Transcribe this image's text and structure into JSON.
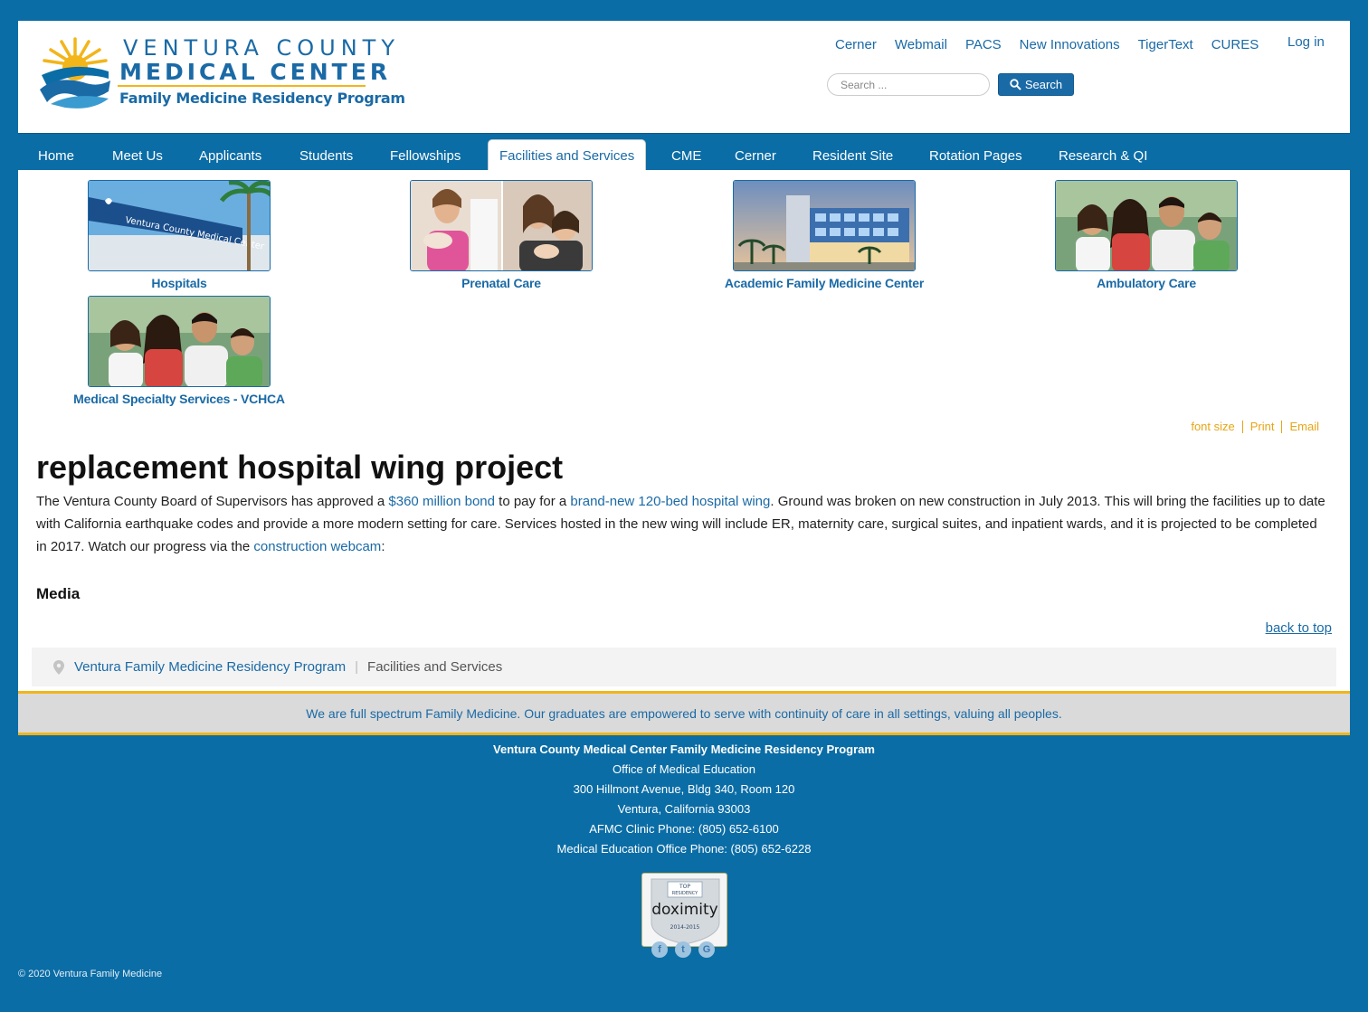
{
  "logo": {
    "line1": "VENTURA COUNTY",
    "line2": "MEDICAL CENTER",
    "line3": "Family Medicine Residency Program"
  },
  "header": {
    "links": [
      "Cerner",
      "Webmail",
      "PACS",
      "New Innovations",
      "TigerText",
      "CURES"
    ],
    "login": "Log in",
    "search": {
      "placeholder": "Search ...",
      "button": "Search"
    }
  },
  "nav": {
    "items": [
      "Home",
      "Meet Us",
      "Applicants",
      "Students",
      "Fellowships",
      "Facilities and Services",
      "CME",
      "Cerner",
      "Resident Site",
      "Rotation Pages",
      "Research & QI"
    ],
    "active": "Facilities and Services"
  },
  "cards": [
    {
      "caption": "Hospitals",
      "image": "hospital-sign-image"
    },
    {
      "caption": "Prenatal Care",
      "image": "prenatal-care-image"
    },
    {
      "caption": "Academic Family Medicine Center",
      "image": "clinic-building-image"
    },
    {
      "caption": "Ambulatory Care",
      "image": "family-photo-image"
    },
    {
      "caption": "Medical Specialty Services - VCHCA",
      "image": "family-photo-image"
    }
  ],
  "tools": {
    "font_size": "font size",
    "print": "Print",
    "email": "Email"
  },
  "article": {
    "title": "replacement hospital wing project",
    "p_1": "The Ventura County Board of Supervisors has approved a ",
    "link_bond": "$360 million bond",
    "p_2": " to pay for a ",
    "link_wing": "brand-new 120-bed hospital wing",
    "p_3": ". Ground was broken on new construction in July 2013. This will bring the facilities up to date with California earthquake codes and provide a more modern setting for care. Services hosted in the new wing will include ER, maternity care, surgical suites, and inpatient wards, and it is projected to be completed in 2017. Watch our progress via the ",
    "link_webcam": "construction webcam",
    "p_4": ":",
    "media": "Media",
    "back_to_top": "back to top"
  },
  "breadcrumb": {
    "home": "Ventura Family Medicine Residency Program",
    "current": "Facilities and Services"
  },
  "mission": "We are full spectrum Family Medicine. Our graduates are empowered to serve with continuity of care in all settings, valuing all peoples.",
  "footer": {
    "lines": [
      "Ventura County Medical Center Family Medicine Residency Program",
      "Office of Medical Education",
      "300 Hillmont Avenue, Bldg 340, Room 120",
      "Ventura, California 93003",
      "AFMC Clinic Phone: (805) 652-6100",
      "Medical Education Office Phone: (805) 652-6228"
    ],
    "badge": {
      "top": "TOP",
      "residency": "RESIDENCY",
      "brand": "doximity",
      "years": "2014-2015"
    },
    "social": [
      "f",
      "t",
      "G"
    ],
    "copyright": "© 2020 Ventura Family Medicine"
  },
  "colors": {
    "brand_blue": "#0b6da6",
    "link_blue": "#1a6aa6",
    "gold": "#f2b51a"
  }
}
